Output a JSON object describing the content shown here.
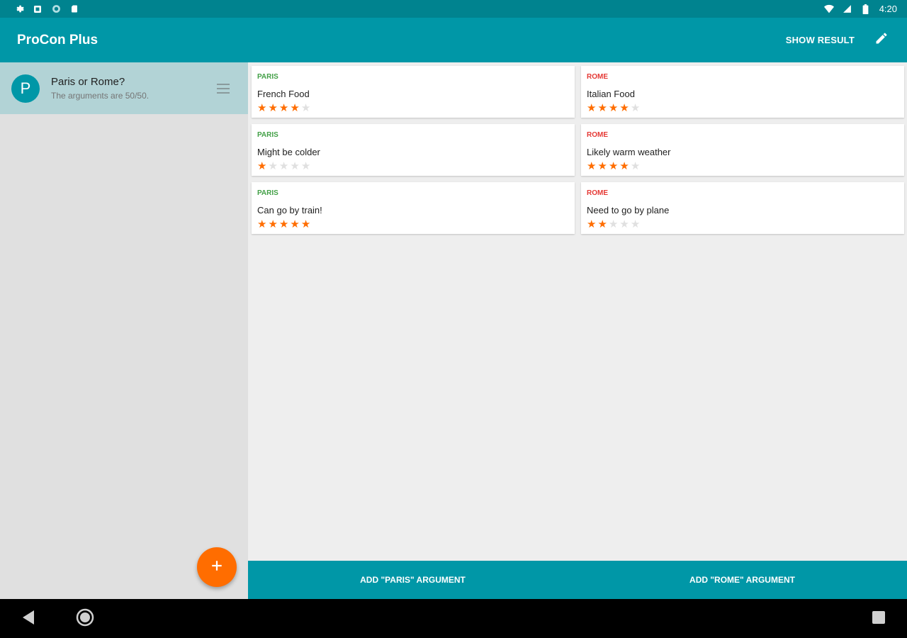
{
  "status_bar": {
    "time": "4:20",
    "left_icons": [
      "settings-icon",
      "notification-icon",
      "sync-icon",
      "sd-card-icon"
    ],
    "right_icons": [
      "wifi-icon",
      "cell-signal-icon",
      "battery-icon"
    ]
  },
  "app_bar": {
    "title": "ProCon Plus",
    "show_result_label": "SHOW RESULT",
    "edit_icon": "pencil-icon"
  },
  "sidebar": {
    "items": [
      {
        "avatar_letter": "P",
        "title": "Paris or Rome?",
        "subtitle": "The arguments are 50/50."
      }
    ],
    "fab_icon": "plus-icon"
  },
  "arguments": {
    "left": [
      {
        "tag": "PARIS",
        "text": "French Food",
        "rating": 4
      },
      {
        "tag": "PARIS",
        "text": "Might be colder",
        "rating": 1
      },
      {
        "tag": "PARIS",
        "text": "Can go by train!",
        "rating": 5
      }
    ],
    "right": [
      {
        "tag": "ROME",
        "text": "Italian Food",
        "rating": 4
      },
      {
        "tag": "ROME",
        "text": "Likely warm weather",
        "rating": 4
      },
      {
        "tag": "ROME",
        "text": "Need to go by plane",
        "rating": 2
      }
    ],
    "max_rating": 5
  },
  "action_bar": {
    "add_left_label": "ADD \"PARIS\" ARGUMENT",
    "add_right_label": "ADD \"ROME\" ARGUMENT"
  },
  "colors": {
    "primary": "#0097a7",
    "primary_dark": "#00838f",
    "accent": "#ff6d00",
    "paris": "#43a047",
    "rome": "#e53935"
  }
}
